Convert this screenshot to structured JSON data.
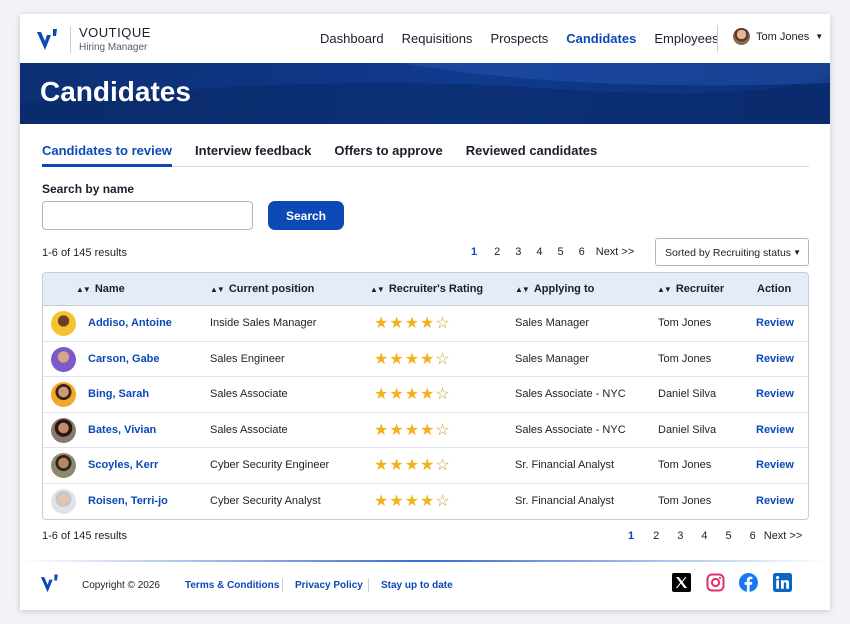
{
  "brand": {
    "name": "VOUTIQUE",
    "subtitle": "Hiring Manager"
  },
  "nav": {
    "links": [
      "Dashboard",
      "Requisitions",
      "Prospects",
      "Candidates",
      "Employees"
    ],
    "active": "Candidates",
    "user_name": "Tom Jones"
  },
  "hero": {
    "title": "Candidates"
  },
  "tabs": [
    "Candidates to review",
    "Interview feedback",
    "Offers to approve",
    "Reviewed candidates"
  ],
  "active_tab": "Candidates to review",
  "search": {
    "label": "Search by name",
    "value": "",
    "placeholder": "",
    "button": "Search"
  },
  "results_text": "1-6 of 145 results",
  "pagination": {
    "pages": [
      "1",
      "2",
      "3",
      "4",
      "5",
      "6"
    ],
    "current": "1",
    "next": "Next >>"
  },
  "sort": {
    "selected": "Sorted by Recruiting status"
  },
  "table": {
    "columns": [
      "Name",
      "Current position",
      "Recruiter's Rating",
      "Applying to",
      "Recruiter",
      "Action"
    ],
    "rows": [
      {
        "name": "Addiso, Antoine",
        "position": "Inside Sales Manager",
        "rating": 4,
        "applying": "Sales Manager",
        "recruiter": "Tom Jones",
        "action": "Review"
      },
      {
        "name": "Carson, Gabe",
        "position": "Sales Engineer",
        "rating": 4,
        "applying": "Sales Manager",
        "recruiter": "Tom Jones",
        "action": "Review"
      },
      {
        "name": "Bing, Sarah",
        "position": "Sales Associate",
        "rating": 4,
        "applying": "Sales Associate - NYC",
        "recruiter": "Daniel Silva",
        "action": "Review"
      },
      {
        "name": "Bates, Vivian",
        "position": "Sales Associate",
        "rating": 4,
        "applying": "Sales Associate - NYC",
        "recruiter": "Daniel Silva",
        "action": "Review"
      },
      {
        "name": "Scoyles, Kerr",
        "position": "Cyber Security Engineer",
        "rating": 4,
        "applying": "Sr. Financial Analyst",
        "recruiter": "Tom Jones",
        "action": "Review"
      },
      {
        "name": "Roisen, Terri-jo",
        "position": "Cyber Security Analyst",
        "rating": 4,
        "applying": "Sr. Financial Analyst",
        "recruiter": "Tom Jones",
        "action": "Review"
      }
    ],
    "rating_max": 5
  },
  "footer": {
    "copyright": "Copyright © 2026",
    "links": [
      "Terms & Conditions",
      "Privacy Policy",
      "Stay up to date"
    ],
    "social_icons": [
      "x-icon",
      "instagram-icon",
      "facebook-icon",
      "linkedin-icon"
    ]
  },
  "colors": {
    "accent": "#0b49b5",
    "hero": "#0d2f74",
    "star": "#f2b21c"
  }
}
